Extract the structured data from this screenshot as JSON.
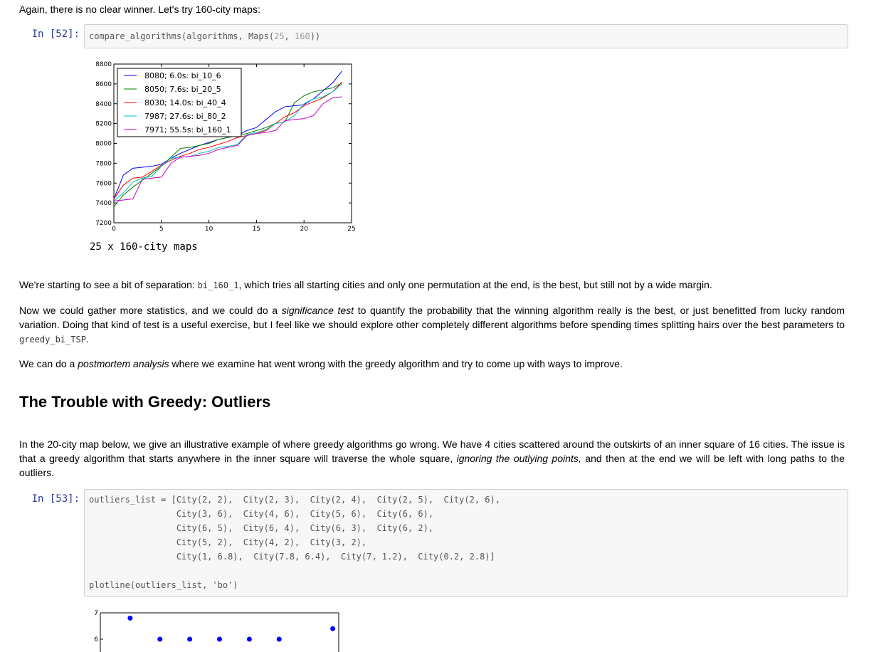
{
  "intro_text": "Again, there is no clear winner. Let's try 160-city maps:",
  "cell52": {
    "prompt": "In [52]:",
    "code_fn": "compare_algorithms(algorithms, Maps(",
    "code_n1": "25",
    "code_sep": ", ",
    "code_n2": "160",
    "code_end": "))"
  },
  "chart_caption": "25 x 160-city maps",
  "chart_data": {
    "type": "line",
    "xlim": [
      0,
      25
    ],
    "ylim": [
      7200,
      8800
    ],
    "xticks": [
      "0",
      "5",
      "10",
      "15",
      "20",
      "25"
    ],
    "yticks": [
      "7200",
      "7400",
      "7600",
      "7800",
      "8000",
      "8200",
      "8400",
      "8600",
      "8800"
    ],
    "legend_placement": "upper-left",
    "series": [
      {
        "name": "8080; 6.0s: bi_10_6",
        "color": "#0000ff",
        "values": [
          7440,
          7680,
          7750,
          7760,
          7770,
          7790,
          7850,
          7900,
          7940,
          7980,
          8010,
          8040,
          8060,
          8080,
          8130,
          8160,
          8240,
          8320,
          8370,
          8380,
          8390,
          8450,
          8530,
          8610,
          8730
        ]
      },
      {
        "name": "8050; 7.6s: bi_20_5",
        "color": "#008000",
        "values": [
          7360,
          7480,
          7560,
          7630,
          7700,
          7770,
          7860,
          7950,
          7960,
          7980,
          8000,
          8040,
          8060,
          8080,
          8100,
          8130,
          8160,
          8200,
          8220,
          8410,
          8480,
          8520,
          8540,
          8560,
          8610
        ]
      },
      {
        "name": "8030; 14.0s: bi_40_4",
        "color": "#ff0000",
        "values": [
          7440,
          7580,
          7650,
          7660,
          7720,
          7780,
          7830,
          7870,
          7900,
          7940,
          7960,
          7990,
          8020,
          8060,
          8080,
          8100,
          8130,
          8200,
          8270,
          8310,
          8380,
          8420,
          8460,
          8520,
          8620
        ]
      },
      {
        "name": "7987; 27.6s: bi_80_2",
        "color": "#00bfbf",
        "values": [
          7420,
          7500,
          7610,
          7650,
          7670,
          7770,
          7850,
          7860,
          7870,
          7900,
          7920,
          7960,
          7970,
          7990,
          8090,
          8110,
          8140,
          8200,
          8220,
          8280,
          8400,
          8450,
          8470,
          8520,
          8600
        ]
      },
      {
        "name": "7971; 55.5s: bi_160_1",
        "color": "#bf00bf",
        "values": [
          7420,
          7430,
          7440,
          7640,
          7650,
          7660,
          7800,
          7860,
          7870,
          7880,
          7900,
          7940,
          7960,
          7980,
          8080,
          8100,
          8110,
          8130,
          8230,
          8240,
          8250,
          8280,
          8400,
          8460,
          8470
        ]
      }
    ]
  },
  "para1": {
    "a": "We're starting to see a bit of separation: ",
    "code": "bi_160_1",
    "b": ", which tries all starting cities and only one permutation at the end, is the best, but still not by a wide margin."
  },
  "para2": {
    "a": "Now we could gather more statistics, and we could do a ",
    "em": "significance test",
    "b": " to quantify the probability that the winning algorithm really is the best, or just benefitted from lucky random variation. Doing that kind of test is a useful exercise, but I feel like we should explore other completely different algorithms before spending times splitting hairs over the best parameters to ",
    "code": "greedy_bi_TSP",
    "c": "."
  },
  "para3": {
    "a": "We can do a ",
    "em": "postmortem analysis",
    "b": " where we examine hat went wrong with the greedy algorithm and try to come up with ways to improve."
  },
  "heading": "The Trouble with Greedy: Outliers",
  "para4": {
    "a": "In the 20-city map below, we give an illustrative example of where greedy algorithms go wrong. We have 4 cities scattered around the outskirts of an inner square of 16 cities. The issue is that a greedy algorithm that starts anywhere in the inner square will traverse the whole square, ",
    "em": "ignoring the outlying points,",
    "b": " and then at the end we will be left with long paths to the outliers."
  },
  "cell53": {
    "prompt": "In [53]:",
    "line1": "outliers_list = [City(2, 2),  City(2, 3),  City(2, 4),  City(2, 5),  City(2, 6),",
    "line2": "                 City(3, 6),  City(4, 6),  City(5, 6),  City(6, 6),",
    "line3": "                 City(6, 5),  City(6, 4),  City(6, 3),  City(6, 2),",
    "line4": "                 City(5, 2),  City(4, 2),  City(3, 2),",
    "line5": "                 City(1, 6.8),  City(7.8, 6.4),  City(7, 1.2),  City(0.2, 2.8)]",
    "line6": "plotline(outliers_list, 'bo')"
  },
  "outlier_plot": {
    "yticks": [
      "7",
      "6"
    ],
    "points_visible": [
      [
        1,
        6.8
      ],
      [
        2,
        6
      ],
      [
        3,
        6
      ],
      [
        4,
        6
      ],
      [
        5,
        6
      ],
      [
        6,
        6
      ],
      [
        7.8,
        6.4
      ]
    ]
  }
}
